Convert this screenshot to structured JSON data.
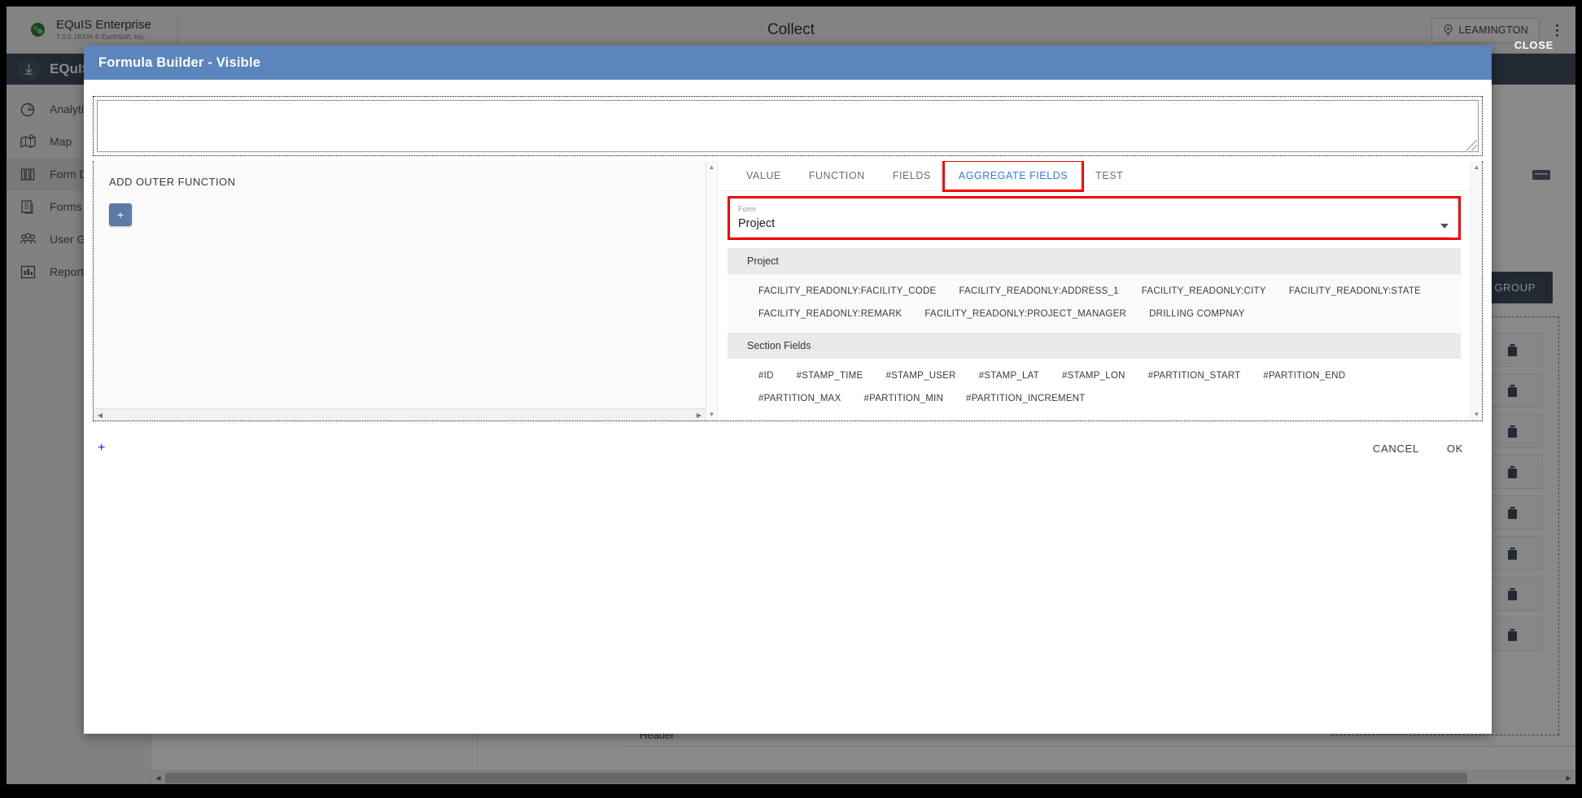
{
  "enterprise": {
    "product_name": "EQuIS Enterprise",
    "version_line": "7.0.0.18334 © EarthSoft, Inc.",
    "center_title": "Collect",
    "user_label": "LEAMINGTON",
    "globe_icon": "globe-icon",
    "pin_icon": "location-pin-icon",
    "kebab_icon": "kebab-menu-icon"
  },
  "appbar": {
    "brand": "EQuIS",
    "brand_icon": "equis-drop-icon"
  },
  "sidebar": {
    "items": [
      {
        "label": "Analytics",
        "icon": "pie-chart-icon",
        "active": false
      },
      {
        "label": "Map",
        "icon": "map-icon",
        "active": false
      },
      {
        "label": "Form Designer",
        "icon": "books-icon",
        "active": true
      },
      {
        "label": "Forms",
        "icon": "documents-icon",
        "active": false
      },
      {
        "label": "User Groups",
        "icon": "people-icon",
        "active": false
      },
      {
        "label": "Reports",
        "icon": "bar-chart-icon",
        "active": false
      }
    ]
  },
  "background": {
    "close_label": "CLOSE",
    "add_group_label": "ADD GROUP",
    "header_label": "Header",
    "toolbar_icon": "grid-icon",
    "row_edit_icon": "pencil-icon",
    "row_delete_icon": "trash-icon",
    "row_count": 8
  },
  "modal": {
    "title": "Formula Builder - Visible",
    "formula_value": "",
    "formula_placeholder": "",
    "left_panel": {
      "add_outer_function_label": "ADD OUTER FUNCTION",
      "add_button_label": "+"
    },
    "tabs": [
      {
        "label": "VALUE",
        "active": false,
        "highlighted": false
      },
      {
        "label": "FUNCTION",
        "active": false,
        "highlighted": false
      },
      {
        "label": "FIELDS",
        "active": false,
        "highlighted": false
      },
      {
        "label": "AGGREGATE FIELDS",
        "active": true,
        "highlighted": true
      },
      {
        "label": "TEST",
        "active": false,
        "highlighted": false
      }
    ],
    "form_select": {
      "label": "Form",
      "value": "Project",
      "caret_icon": "chevron-down-icon"
    },
    "groups": [
      {
        "header": "Project",
        "chips": [
          "FACILITY_READONLY:FACILITY_CODE",
          "FACILITY_READONLY:ADDRESS_1",
          "FACILITY_READONLY:CITY",
          "FACILITY_READONLY:STATE",
          "FACILITY_READONLY:REMARK",
          "FACILITY_READONLY:PROJECT_MANAGER",
          "DRILLING COMPNAY"
        ]
      },
      {
        "header": "Section Fields",
        "chips": [
          "#ID",
          "#STAMP_TIME",
          "#STAMP_USER",
          "#STAMP_LAT",
          "#STAMP_LON",
          "#PARTITION_START",
          "#PARTITION_END",
          "#PARTITION_MAX",
          "#PARTITION_MIN",
          "#PARTITION_INCREMENT"
        ]
      }
    ],
    "footer": {
      "add_link": "+",
      "cancel_label": "CANCEL",
      "ok_label": "OK"
    }
  },
  "colors": {
    "modal_header": "#5b85bc",
    "accent_blue": "#2f7de0",
    "highlight_red": "#f40000",
    "appbar": "#3f4c5f",
    "plus_button": "#5b7ba6"
  },
  "scroll": {
    "up_arrow": "▲",
    "down_arrow": "▼",
    "left_arrow": "◀",
    "right_arrow": "▶"
  }
}
